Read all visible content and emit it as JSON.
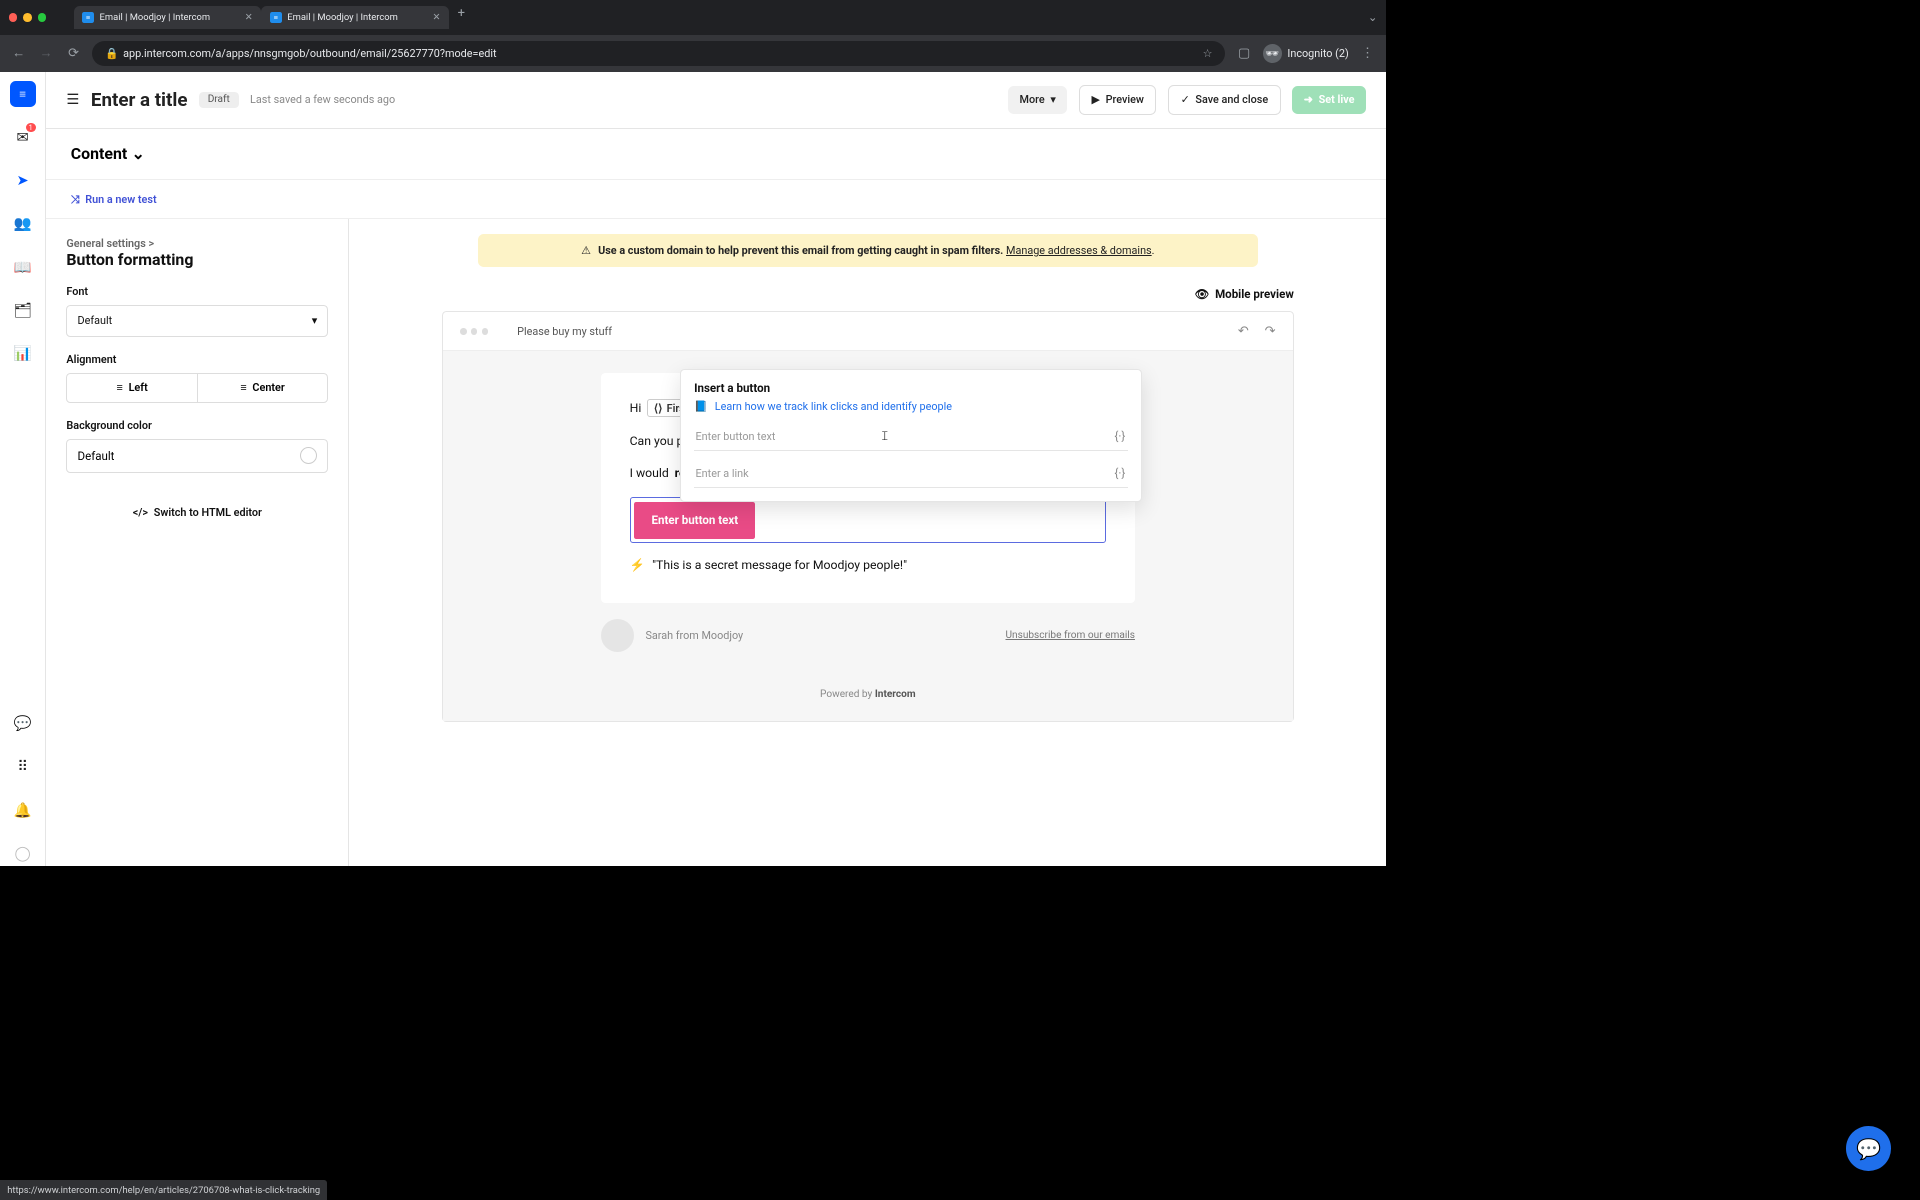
{
  "browser": {
    "tab1": "Email | Moodjoy | Intercom",
    "tab2": "Email | Moodjoy | Intercom",
    "url": "app.intercom.com/a/apps/nnsgmgob/outbound/email/25627770?mode=edit",
    "incognito_label": "Incognito (2)"
  },
  "topbar": {
    "title": "Enter a title",
    "draft": "Draft",
    "lastsaved": "Last saved a few seconds ago",
    "more": "More",
    "preview": "Preview",
    "save": "Save and close",
    "setlive": "Set live"
  },
  "leftrail": {
    "inbox_badge": "1"
  },
  "content": {
    "header": "Content",
    "runtest": "Run a new test"
  },
  "settings": {
    "crumbs": "General settings >",
    "heading": "Button formatting",
    "font_label": "Font",
    "font_value": "Default",
    "align_label": "Alignment",
    "align_left": "Left",
    "align_center": "Center",
    "bg_label": "Background color",
    "bg_value": "Default",
    "switch_html": "Switch to HTML editor"
  },
  "canvas": {
    "warning_text": "Use a custom domain to help prevent this email from getting caught in spam filters.",
    "warning_link": "Manage addresses & domains",
    "mobile_preview": "Mobile preview",
    "subject": "Please buy my stuff",
    "body": {
      "hi": "Hi",
      "chip": "First",
      "line2_pre": "Can you ple",
      "line3_pre": "I would ",
      "line3_bold": "rea",
      "button_placeholder": "Enter button text",
      "secret": "\"This is a secret message for Moodjoy people!\""
    },
    "signature": {
      "name": "Sarah from Moodjoy",
      "unsubscribe": "Unsubscribe from our emails"
    },
    "powered_prefix": "Powered by ",
    "powered_brand": "Intercom"
  },
  "popover": {
    "title": "Insert a button",
    "learn": "Learn how we track link clicks and identify people",
    "text_ph": "Enter button text",
    "link_ph": "Enter a link"
  },
  "status_url": "https://www.intercom.com/help/en/articles/2706708-what-is-click-tracking"
}
